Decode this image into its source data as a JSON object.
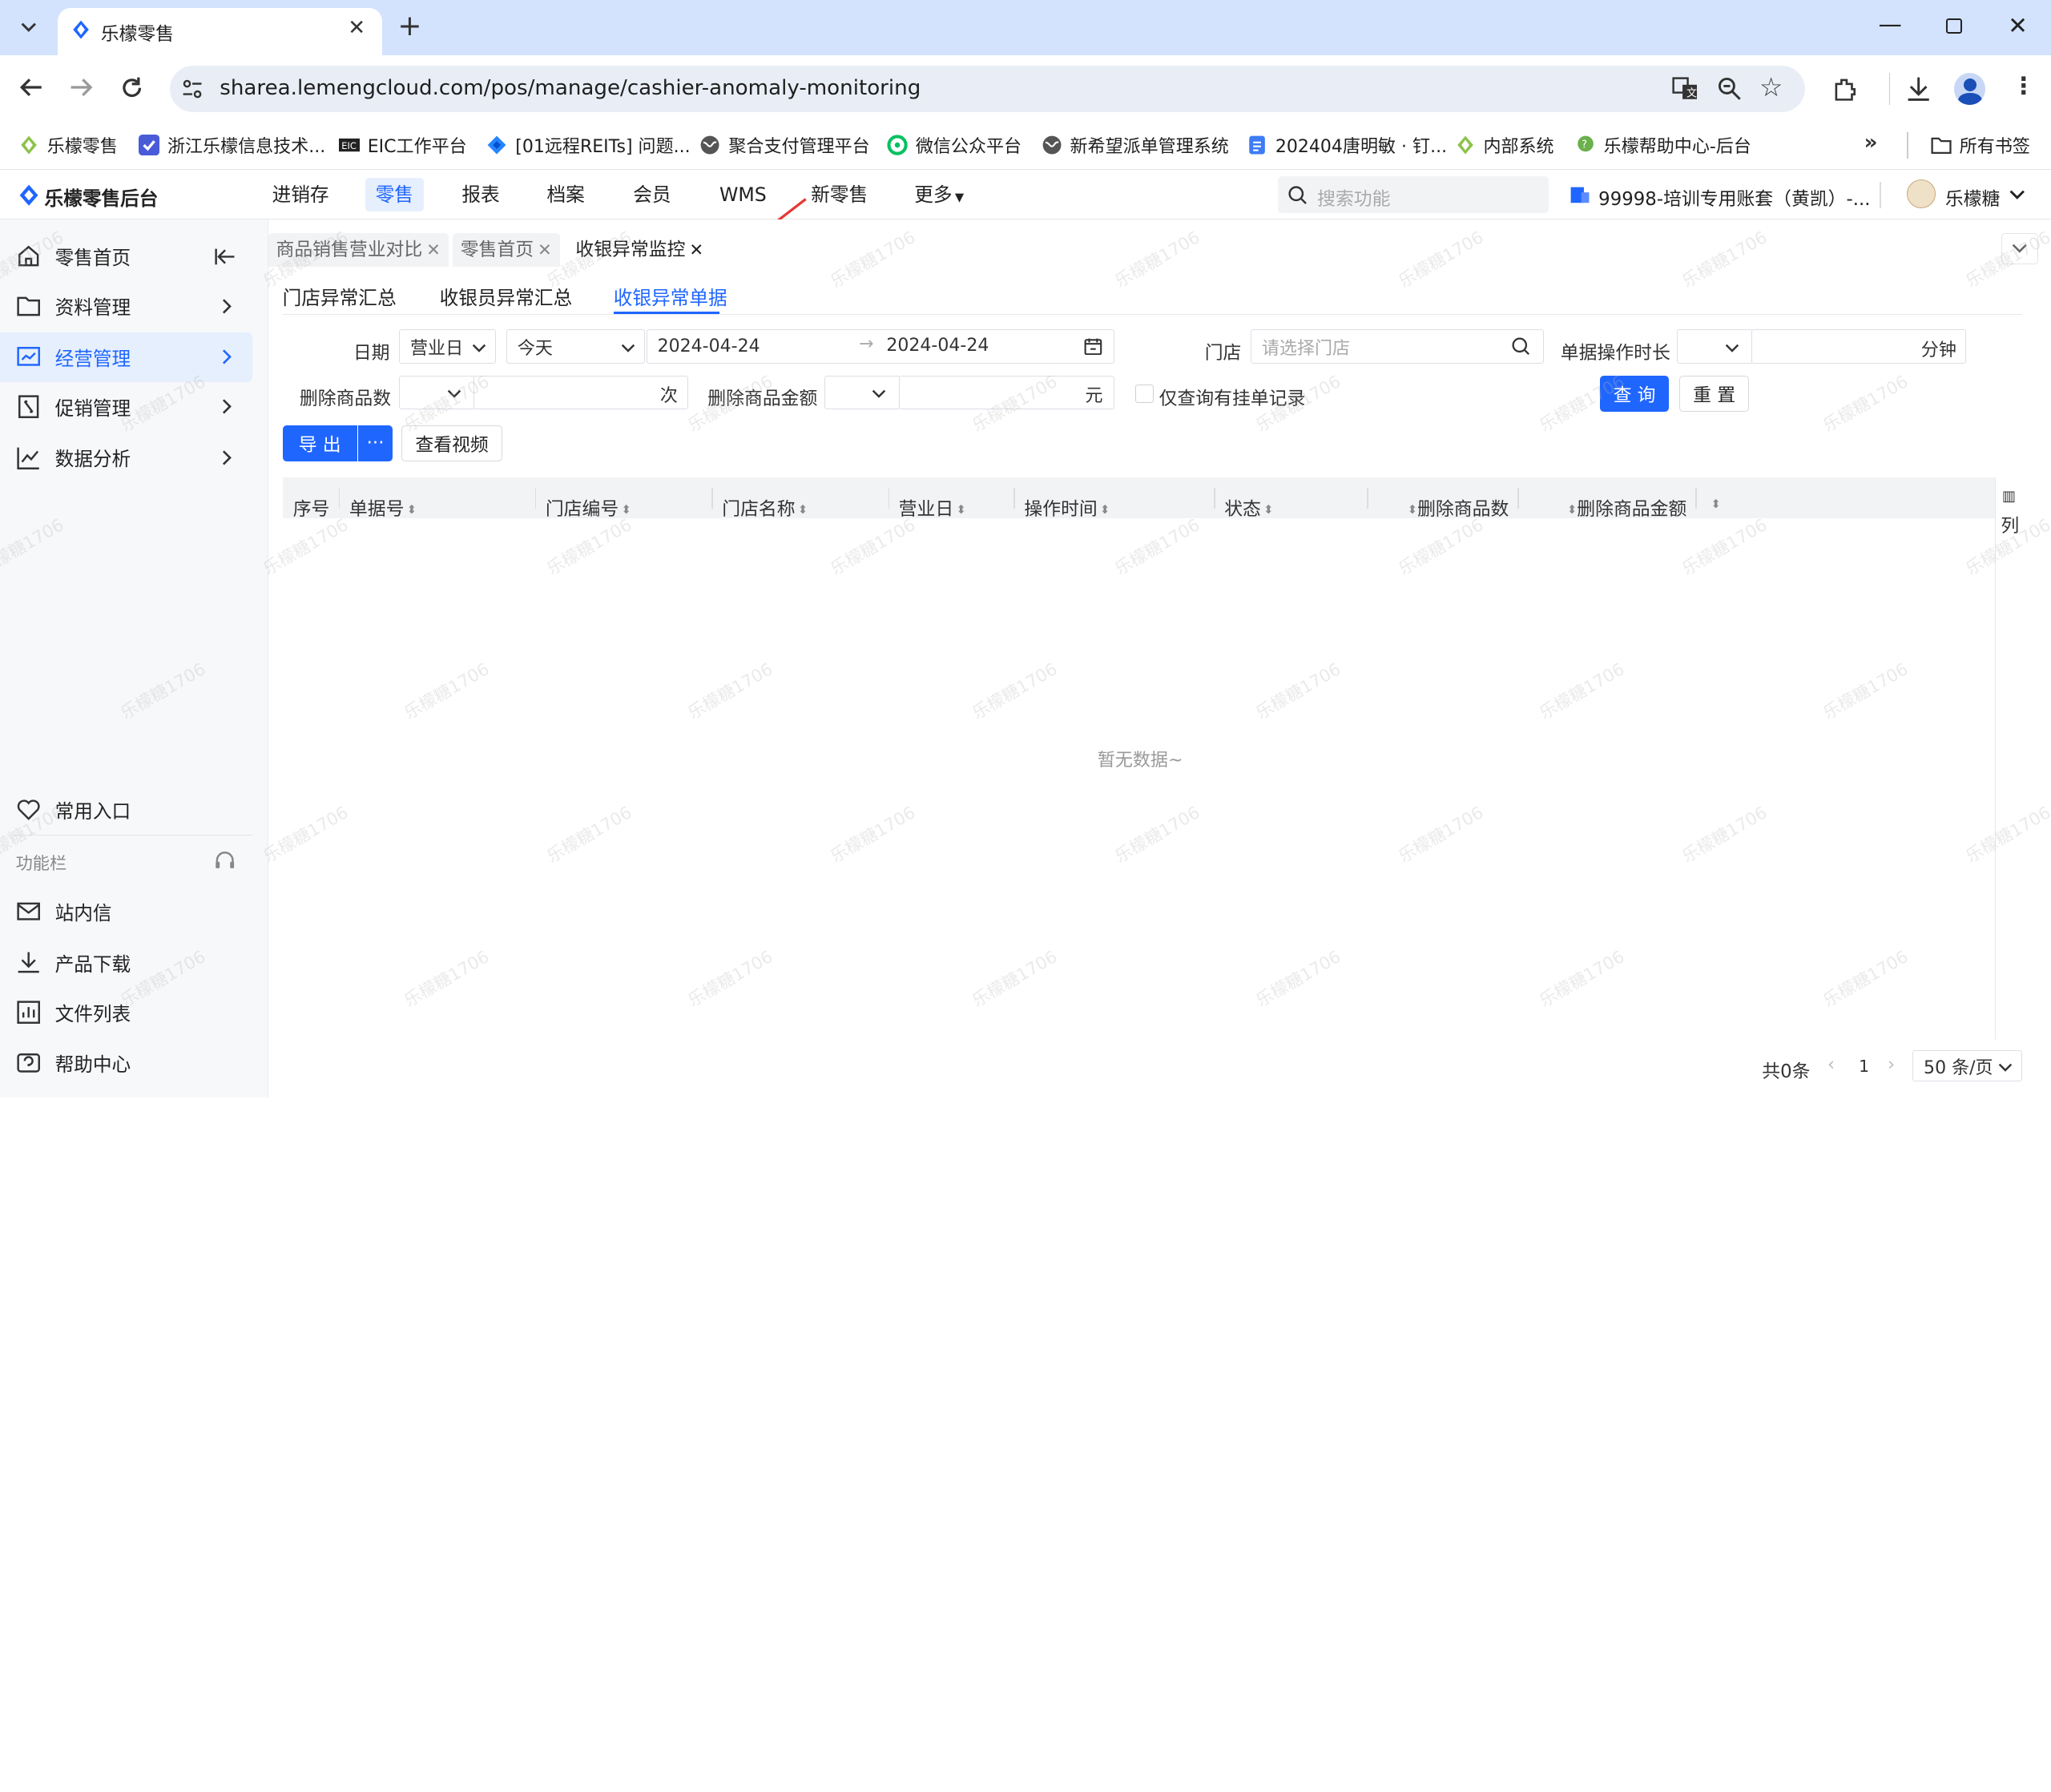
{
  "browser": {
    "tab_title": "乐檬零售",
    "url": "sharea.lemengcloud.com/pos/manage/cashier-anomaly-monitoring",
    "bookmarks": [
      {
        "label": "乐檬零售",
        "icon": "lemon-logo-icon"
      },
      {
        "label": "浙江乐檬信息技术...",
        "icon": "company-logo-icon"
      },
      {
        "label": "EIC工作平台",
        "icon": "eic-logo-icon"
      },
      {
        "label": "[01远程REITs] 问题...",
        "icon": "jira-logo-icon"
      },
      {
        "label": "聚合支付管理平台",
        "icon": "globe-icon"
      },
      {
        "label": "微信公众平台",
        "icon": "wechat-logo-icon"
      },
      {
        "label": "新希望派单管理系统",
        "icon": "globe-icon"
      },
      {
        "label": "202404唐明敏 · 钉...",
        "icon": "doc-icon"
      },
      {
        "label": "内部系统",
        "icon": "lemon-logo-icon"
      },
      {
        "label": "乐檬帮助中心-后台",
        "icon": "help-logo-icon"
      }
    ],
    "all_bookmarks": "所有书签"
  },
  "app": {
    "logo_text": "乐檬零售后台",
    "nav": [
      "进销存",
      "零售",
      "报表",
      "档案",
      "会员",
      "WMS",
      "新零售",
      "更多"
    ],
    "active_nav": "零售",
    "search_placeholder": "搜索功能",
    "account": "99998-培训专用账套（黄凯）-...",
    "user": "乐檬糖"
  },
  "sidebar": {
    "items": [
      {
        "label": "零售首页",
        "icon": "home-icon"
      },
      {
        "label": "资料管理",
        "icon": "folder-icon"
      },
      {
        "label": "经营管理",
        "icon": "chart-board-icon",
        "active": true
      },
      {
        "label": "促销管理",
        "icon": "promotion-icon"
      },
      {
        "label": "数据分析",
        "icon": "line-chart-icon"
      }
    ],
    "favorites": "常用入口",
    "section_label": "功能栏",
    "bottom_items": [
      {
        "label": "站内信",
        "icon": "mail-icon"
      },
      {
        "label": "产品下载",
        "icon": "download-icon"
      },
      {
        "label": "文件列表",
        "icon": "file-list-icon"
      },
      {
        "label": "帮助中心",
        "icon": "help-icon"
      }
    ]
  },
  "page_tabs": [
    {
      "label": "商品销售营业对比"
    },
    {
      "label": "零售首页"
    },
    {
      "label": "收银异常监控",
      "active": true
    }
  ],
  "sub_tabs": [
    "门店异常汇总",
    "收银员异常汇总",
    "收银异常单据"
  ],
  "active_sub_tab": "收银异常单据",
  "filters": {
    "date_label": "日期",
    "date_type": "营业日",
    "date_preset": "今天",
    "date_start": "2024-04-24",
    "date_end": "2024-04-24",
    "store_label": "门店",
    "store_placeholder": "请选择门店",
    "duration_label": "单据操作时长",
    "duration_unit": "分钟",
    "delete_count_label": "删除商品数",
    "delete_count_unit": "次",
    "delete_amount_label": "删除商品金额",
    "delete_amount_unit": "元",
    "pending_only_label": "仅查询有挂单记录",
    "query_button": "查 询",
    "reset_button": "重 置"
  },
  "toolbar": {
    "export_button": "导 出",
    "more_button": "···",
    "view_video_button": "查看视频"
  },
  "table": {
    "columns": [
      "序号",
      "单据号",
      "门店编号",
      "门店名称",
      "营业日",
      "操作时间",
      "状态",
      "删除商品数",
      "删除商品金额"
    ],
    "empty_text": "暂无数据~",
    "column_setting": "列"
  },
  "pagination": {
    "total": "共0条",
    "current_page": "1",
    "page_size": "50 条/页"
  },
  "watermark": "乐檬糖1706"
}
